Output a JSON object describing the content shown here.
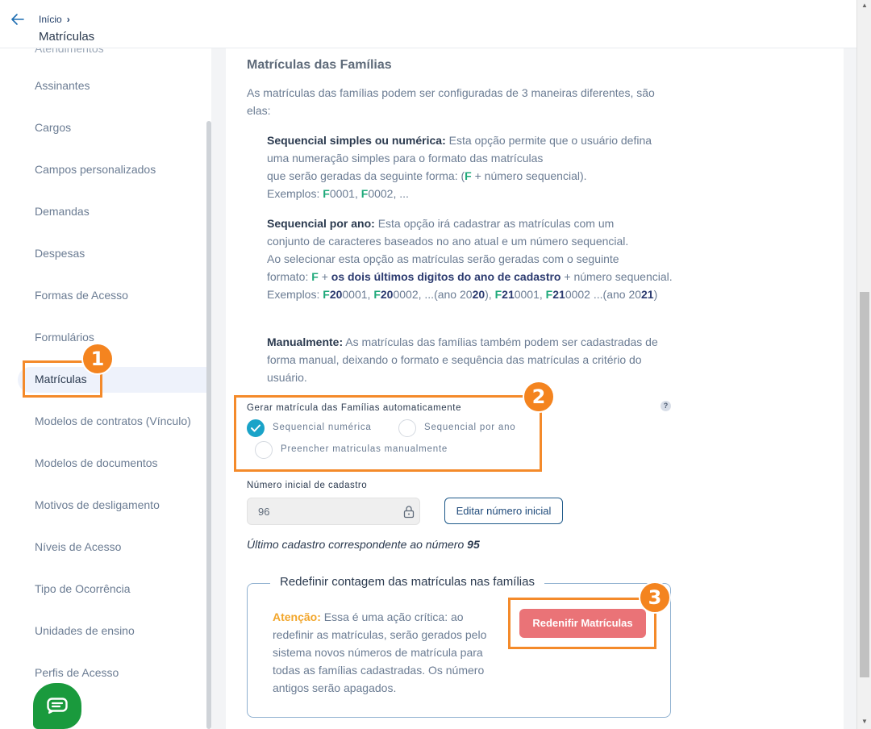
{
  "header": {
    "breadcrumb": "Início",
    "breadcrumb_sep": "›",
    "title": "Matrículas"
  },
  "sidebar": {
    "items": [
      {
        "label": "Assinantes"
      },
      {
        "label": "Cargos"
      },
      {
        "label": "Campos personalizados"
      },
      {
        "label": "Demandas"
      },
      {
        "label": "Despesas"
      },
      {
        "label": "Formas de Acesso"
      },
      {
        "label": "Formulários"
      },
      {
        "label": "Matrículas",
        "active": true
      },
      {
        "label": "Modelos de contratos (Vínculo)"
      },
      {
        "label": "Modelos de documentos"
      },
      {
        "label": "Motivos de desligamento"
      },
      {
        "label": "Níveis de Acesso"
      },
      {
        "label": "Tipo de Ocorrência"
      },
      {
        "label": "Unidades de ensino"
      },
      {
        "label": "Perfis de Acesso"
      }
    ]
  },
  "main": {
    "section_title": "Matrículas das Famílias",
    "intro": "As matrículas das famílias podem ser configuradas de 3 maneiras diferentes, são elas:",
    "opt1": {
      "title": "Sequencial simples ou numérica:",
      "line1": "Esta opção permite que o usuário defina",
      "line2": "uma numeração simples para o formato das matrículas",
      "line3a": "que serão geradas da seguinte forma: (",
      "f": "F",
      "line3b": " + número sequencial).",
      "ex_label": "Exemplos: ",
      "ex1": "0001",
      "ex2": "0002",
      "ex_end": ", ..."
    },
    "opt2": {
      "title": "Sequencial por ano:",
      "line1": "Esta opção irá cadastrar as matrículas com um",
      "line2": "conjunto de caracteres baseados no ano atual e um número sequencial.",
      "line3": "Ao selecionar esta opção as matrículas serão geradas com o seguinte",
      "line4a": "formato: ",
      "plus": " + ",
      "bold": "os dois últimos digitos do ano de cadastro",
      "line4b": " + número sequencial.",
      "ex_label": "Exemplos: ",
      "y20": "20",
      "y21": "21",
      "n1": "0001",
      "n2": "0002",
      "mid1": ", ...(ano 20",
      "mid2": "), ",
      "mid3": ", ",
      "mid4": " ...(ano 20",
      "end": ")"
    },
    "opt3": {
      "title": "Manualmente:",
      "text": "As matrículas das famílias também podem ser cadastradas de forma manual, deixando o formato e sequência das matrículas a critério do usuário."
    },
    "radio_group": {
      "label": "Gerar matrícula das Famílias automaticamente",
      "help": "?",
      "options": [
        {
          "label": "Sequencial numérica",
          "checked": true
        },
        {
          "label": "Sequencial por ano",
          "checked": false
        },
        {
          "label": "Preencher matriculas manualmente",
          "checked": false
        }
      ]
    },
    "initial_number": {
      "label": "Número inicial de cadastro",
      "value": "96",
      "edit_button": "Editar número inicial"
    },
    "last_record": {
      "text": "Último cadastro correspondente ao número ",
      "number": "95"
    },
    "reset": {
      "legend": "Redefinir contagem das matrículas nas famílias",
      "warning_word": "Atenção:",
      "warning_text": " Essa é uma ação crítica: ao redefinir as matrículas, serão gerados pelo sistema novos números de matrícula para todas as famílias cadastradas. Os número antigos serão apagados.",
      "button": "Redenifir Matrículas"
    }
  },
  "annotations": {
    "badge1": "1",
    "badge2": "2",
    "badge3": "3",
    "color": "#f48a2a"
  },
  "icons": {
    "back": "arrow-left-icon",
    "lock": "lock-icon",
    "check": "check-icon",
    "chat": "chat-icon"
  }
}
